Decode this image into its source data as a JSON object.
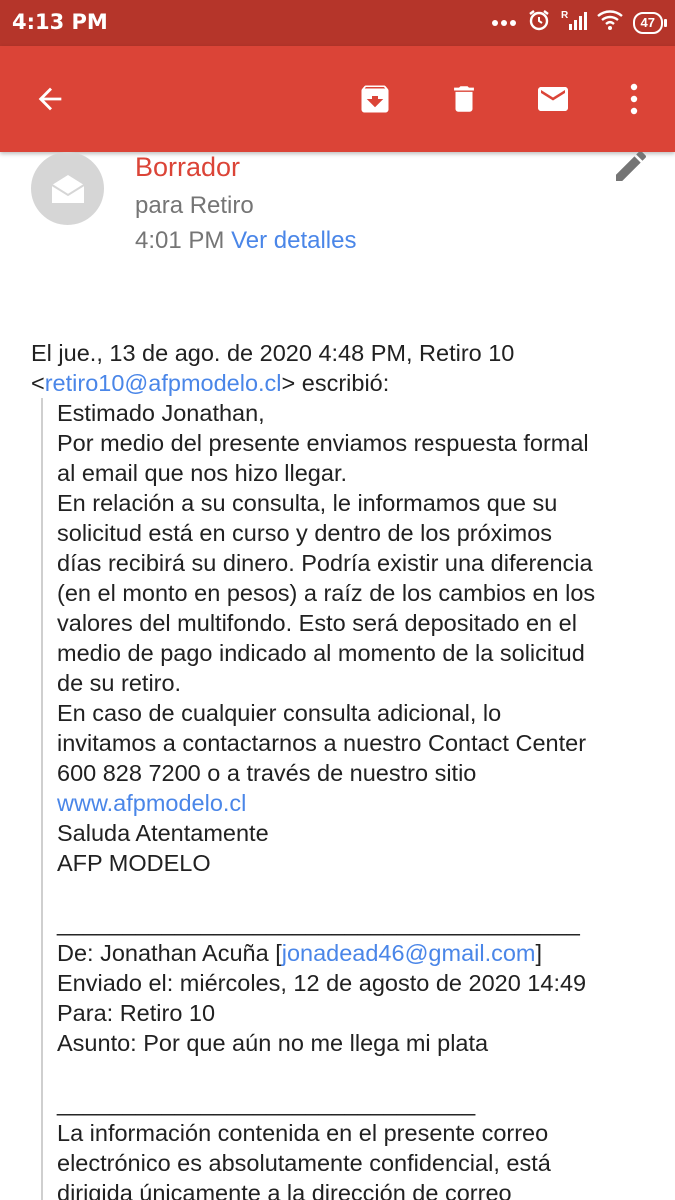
{
  "status_bar": {
    "time": "4:13 PM",
    "battery": "47"
  },
  "toolbar": {
    "back_icon": "arrow-back-icon",
    "archive_icon": "archive-icon",
    "delete_icon": "delete-icon",
    "mark_unread_icon": "mail-icon",
    "more_icon": "more-vert-icon",
    "color": "#db4437"
  },
  "message": {
    "label": "Borrador",
    "recipient": "para Retiro",
    "time": "4:01 PM",
    "details_link": "Ver detalles"
  },
  "quoted": {
    "header_line1": "El jue., 13 de ago. de 2020 4:48 PM, Retiro 10",
    "header_lt": "<",
    "header_email": "retiro10@afpmodelo.cl",
    "header_rest": "> escribió:",
    "lines": [
      "Estimado Jonathan,",
      "Por medio del presente enviamos respuesta formal",
      "al email que nos hizo llegar.",
      "En relación a su consulta, le informamos que su",
      "solicitud está en curso y dentro de los próximos",
      "días recibirá su dinero. Podría existir una diferencia",
      "(en el monto en pesos) a raíz de los cambios en los",
      "valores del multifondo. Esto será depositado en el",
      "medio de pago indicado al momento de la solicitud",
      "de su retiro.",
      "En caso de cualquier consulta adicional, lo",
      "invitamos a contactarnos a nuestro Contact Center",
      "600 828 7200 o a través de nuestro sitio"
    ],
    "website": "www.afpmodelo.cl",
    "signoff1": "Saluda Atentamente",
    "signoff2": "AFP MODELO",
    "separator1": "________________________________________",
    "from_prefix": "De: Jonathan Acuña [",
    "from_email": "jonadead46@gmail.com",
    "from_suffix": "]",
    "sent": "Enviado el: miércoles, 12 de agosto de 2020 14:49",
    "to": "Para: Retiro 10",
    "subject": "Asunto: Por que aún no me llega mi plata",
    "separator2": "________________________________",
    "disclaimer": [
      "La información contenida en el presente correo",
      "electrónico es absolutamente confidencial, está",
      "dirigida únicamente a la dirección de correo"
    ]
  }
}
